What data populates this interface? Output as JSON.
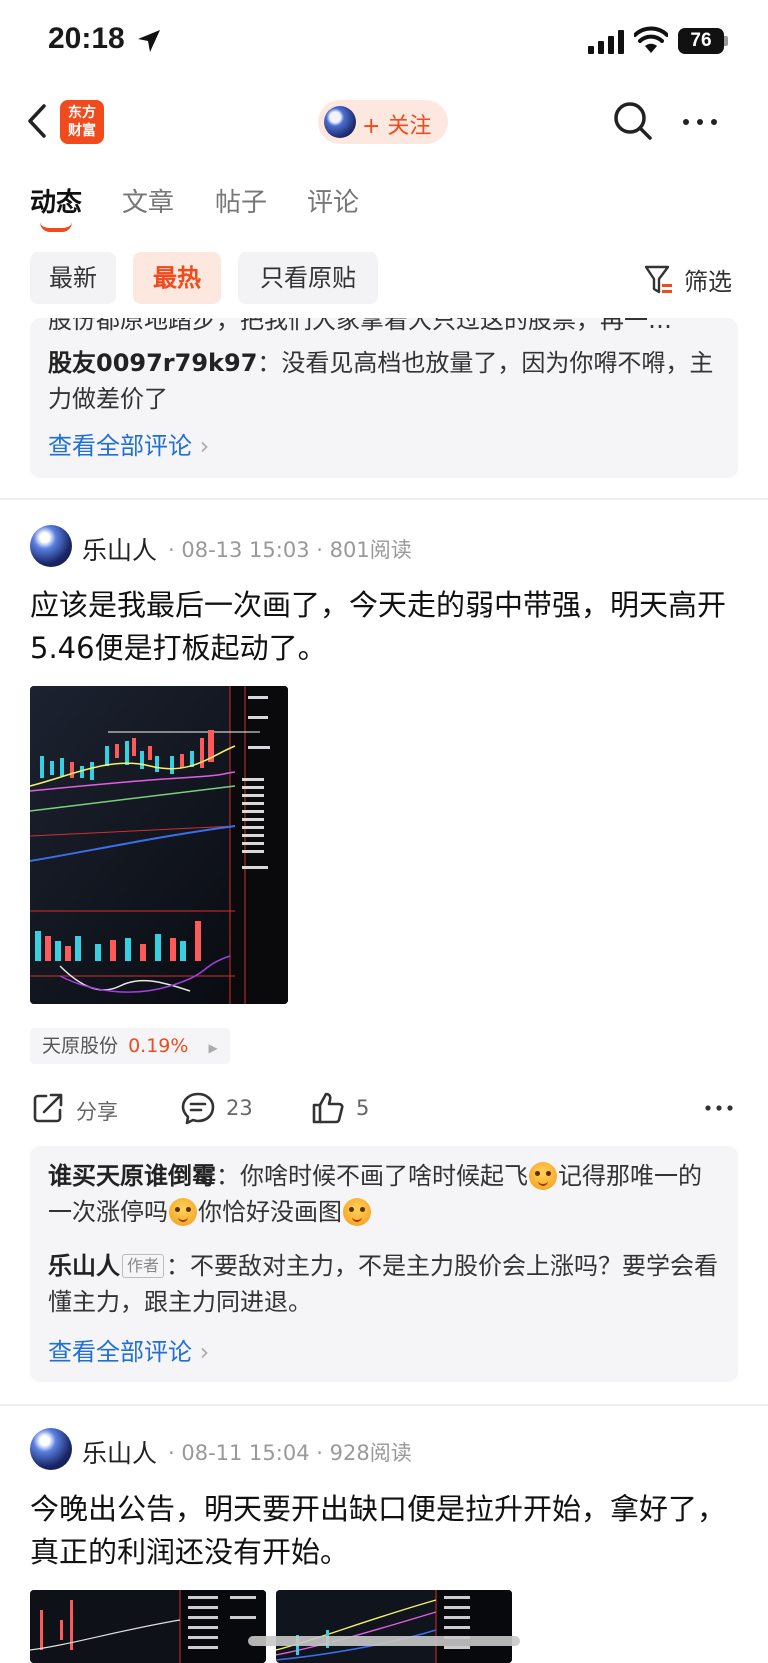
{
  "status_bar": {
    "time": "20:18",
    "battery": "76"
  },
  "nav": {
    "logo_line1": "东方",
    "logo_line2": "财富",
    "follow_label": "+ 关注"
  },
  "tabs": [
    {
      "label": "动态",
      "active": true
    },
    {
      "label": "文章",
      "active": false
    },
    {
      "label": "帖子",
      "active": false
    },
    {
      "label": "评论",
      "active": false
    }
  ],
  "filters": {
    "chips": [
      "最新",
      "最热",
      "只看原贴"
    ],
    "active": "最热",
    "filter_label": "筛选"
  },
  "prev_comments": {
    "cut_text": "股份都原地踏步，把我们大家拿着大只过这的股票，再一…",
    "comment": {
      "user": "股友0097r79k97",
      "text": "没看见高档也放量了，因为你嘚不嘚，主力做差价了"
    },
    "see_all": "查看全部评论"
  },
  "post1": {
    "author": "乐山人",
    "date": "08-13 15:03",
    "reads": "801阅读",
    "text": "应该是我最后一次画了，今天走的弱中带强，明天高开5.46便是打板起动了。",
    "stock": {
      "name": "天原股份",
      "change": "0.19%"
    },
    "actions": {
      "share": "分享",
      "comments": "23",
      "likes": "5"
    },
    "comments": [
      {
        "user": "谁买天原谁倒霉",
        "text1": "你啥时候不画了啥时候起飞",
        "text2": "记得那唯一的一次涨停吗",
        "text3": "你恰好没画图"
      },
      {
        "user": "乐山人",
        "tag": "作者",
        "text": "不要敌对主力，不是主力股价会上涨吗？要学会看懂主力，跟主力同进退。"
      }
    ],
    "see_all": "查看全部评论"
  },
  "post2": {
    "author": "乐山人",
    "date": "08-11 15:04",
    "reads": "928阅读",
    "text": "今晚出公告，明天要开出缺口便是拉升开始，拿好了，真正的利润还没有开始。"
  },
  "colors": {
    "accent": "#f04a1d",
    "link": "#1f6fd6",
    "chip_active_bg": "#fde8df"
  },
  "icons": [
    "location-arrow-icon",
    "signal-icon",
    "wifi-icon",
    "back-icon",
    "search-icon",
    "more-icon",
    "filter-icon",
    "share-icon",
    "comment-icon",
    "like-icon"
  ]
}
